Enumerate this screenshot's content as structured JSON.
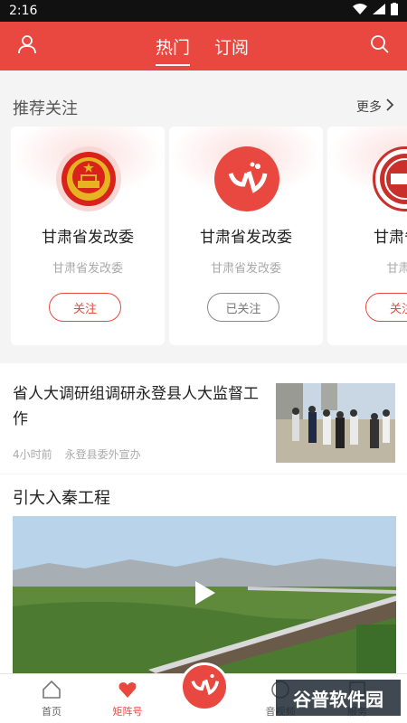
{
  "status": {
    "time": "2:16"
  },
  "topbar": {
    "tab_hot": "热门",
    "tab_subscribe": "订阅"
  },
  "recommend": {
    "title": "推荐关注",
    "more": "更多",
    "cards": [
      {
        "name": "甘肃省发改委",
        "sub": "甘肃省发改委",
        "button": "关注",
        "followed": false
      },
      {
        "name": "甘肃省发改委",
        "sub": "甘肃省发改委",
        "button": "已关注",
        "followed": true
      },
      {
        "name": "甘肃省宗",
        "sub": "甘肃省",
        "button": "关注",
        "followed": false
      }
    ]
  },
  "news": [
    {
      "title": "省人大调研组调研永登县人大监督工作",
      "time": "4小时前",
      "source": "永登县委外宣办"
    },
    {
      "title": "引大入秦工程"
    }
  ],
  "tabbar": {
    "items": [
      "首页",
      "矩阵号",
      "音视频",
      "服务"
    ]
  },
  "watermark": {
    "text": "谷普软件园"
  },
  "colors": {
    "accent": "#e8483f"
  }
}
